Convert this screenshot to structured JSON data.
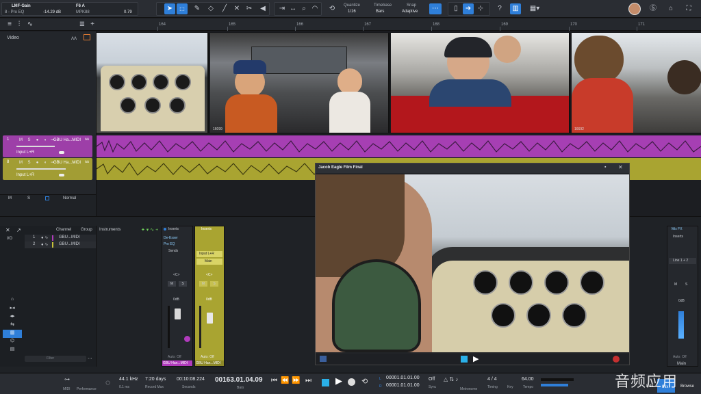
{
  "toolbar": {
    "plugin_name": "LMF-Gain",
    "plugin_sub": "8 - Pro EQ",
    "gain_value": "-14.29 dB",
    "key_name": "F6 A",
    "key_sub": "MPK88",
    "key_value": "0.79",
    "quantize_label": "Quantize",
    "quantize_value": "1/16",
    "timebase_label": "Timebase",
    "timebase_value": "Bars",
    "snap_label": "Snap",
    "snap_value": "Adaptive"
  },
  "ruler": {
    "ticks": [
      "164",
      "165",
      "166",
      "167",
      "168",
      "169",
      "170",
      "171"
    ]
  },
  "tracklist": {
    "video_track_label": "Video"
  },
  "tracks": [
    {
      "num": "1",
      "name": "GBU Ha...MIDI",
      "input": "Input L+R",
      "color": "#b13bbd"
    },
    {
      "num": "8",
      "name": "GBU Ha...MIDI",
      "input": "Input L+R",
      "color": "#a9a431"
    }
  ],
  "video_frames": [
    {
      "timecode": ""
    },
    {
      "timecode": "16099"
    },
    {
      "timecode": ""
    },
    {
      "timecode": "16692"
    }
  ],
  "bottom_track_bar": {
    "m": "M",
    "s": "S",
    "mode": "Normal"
  },
  "browser": {
    "col_channel": "Channel",
    "col_group": "Group",
    "col_instruments": "Instruments",
    "rows": [
      {
        "num": "1",
        "name": "GBU...MIDI",
        "color": "#b13bbd"
      },
      {
        "num": "2",
        "name": "GBU...MIDI",
        "color": "#c9c23a"
      }
    ],
    "filter_placeholder": "Filter",
    "io_label": "I/O"
  },
  "strip1": {
    "inserts": "Inserts",
    "insert_items": [
      "De-Esser",
      "Pro EQ"
    ],
    "sends": "Sends",
    "pan": "<C>",
    "m": "M",
    "s": "S",
    "level": "0dB",
    "auto": "Auto: Off",
    "name": "GBU Han...MIDI",
    "color": "#b13bbd"
  },
  "strip2": {
    "inserts": "Inserts",
    "input": "Input L+R",
    "output": "Main",
    "pan": "<C>",
    "m": "M",
    "s": "S",
    "level": "0dB",
    "auto": "Auto: Off",
    "name": "GBU Han...MIDI",
    "color": "#c9c23a"
  },
  "main_strip": {
    "fx": "Mix FX",
    "inserts": "Inserts",
    "line": "Line 1 + 2",
    "m": "M",
    "s": "S",
    "level": "0dB",
    "auto": "Auto: Off",
    "name": "Main"
  },
  "video_window": {
    "title": "Jacob Eagle Film Final"
  },
  "transport": {
    "midi": "MIDI",
    "performance": "Performance",
    "sample_rate": "44.1 kHz",
    "latency": "0.1 ms",
    "record_max_value": "7:20 days",
    "record_max": "Record Max",
    "seconds_value": "00:10:08.224",
    "seconds": "Seconds",
    "position": "00163.01.04.09",
    "position_unit": "Bars",
    "loop_l": "00001.01.01.00",
    "loop_r": "00001.01.01.00",
    "sync_value": "Off",
    "sync": "Sync",
    "metronome": "Metronome",
    "timing_value": "4 / 4",
    "timing": "Timing",
    "key": "Key",
    "tempo_value": "64.00",
    "tempo": "Tempo",
    "edit": "Edit",
    "mix": "Mix",
    "browse": "Browse"
  },
  "watermark": "音频应用",
  "colors": {
    "accent": "#2f7fd9",
    "track_purple": "#b13bbd",
    "track_yellow": "#a9a431"
  }
}
